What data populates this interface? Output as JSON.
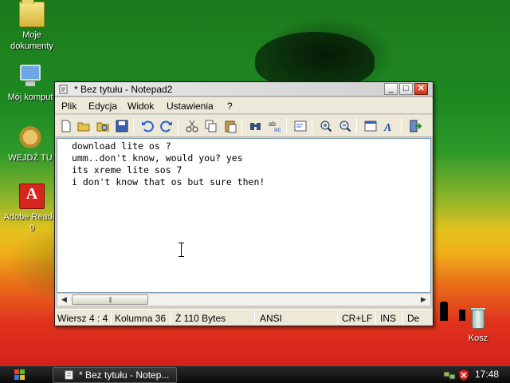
{
  "desktop": {
    "icons": [
      {
        "label": "Moje dokumenty",
        "icon": "folder-icon"
      },
      {
        "label": "Mój komput",
        "icon": "computer-icon"
      },
      {
        "label": "WEJDŹ TU",
        "icon": "shortcut-icon"
      },
      {
        "label": "Adobe Reader 9",
        "icon": "pdf-icon"
      },
      {
        "label": "Kosz",
        "icon": "recycle-bin-icon"
      }
    ]
  },
  "window": {
    "title": "* Bez tytułu - Notepad2",
    "buttons": {
      "minimize": "_",
      "maximize": "□",
      "close": "✕"
    },
    "menu": [
      "Plik",
      "Edycja",
      "Widok",
      "Ustawienia",
      "?"
    ],
    "editor_lines": [
      "download lite os ?",
      "umm..don't know, would you? yes",
      "its xreme lite sos 7",
      "i don't know that os but sure then!"
    ],
    "status": {
      "position": "Wiersz 4 : 4",
      "column": "Kolumna 36",
      "size": "Ż 110 Bytes",
      "encoding": "ANSI",
      "line_ending": "CR+LF",
      "insert_mode": "INS",
      "extra": "De"
    }
  },
  "taskbar": {
    "task_label": "* Bez tytułu - Notep...",
    "clock": "17:48"
  },
  "colors": {
    "wallpaper_green": "#1f8a22",
    "wallpaper_yellow": "#e3c21f",
    "wallpaper_red": "#cf1a1a",
    "window_chrome": "#ece9d8",
    "close_button": "#c9331a"
  }
}
